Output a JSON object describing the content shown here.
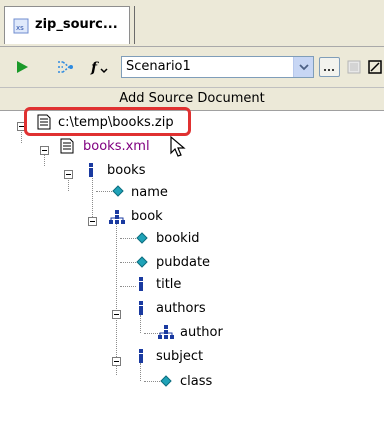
{
  "tab": {
    "title": "zip_sourc...",
    "icon": "xsd-file-icon"
  },
  "toolbar": {
    "run_icon": "play-icon",
    "mapping_icon": "mapping-icon",
    "function_icon": "function-icon",
    "scenario_value": "Scenario1",
    "dropdown_icon": "chevron-down-icon",
    "ellipsis_icon": "ellipsis-icon"
  },
  "source_header": "Add Source Document",
  "tree": {
    "root": {
      "label": "c:\\temp\\books.zip",
      "icon": "document-icon"
    },
    "file": {
      "label": "books.xml",
      "icon": "document-icon",
      "color": "#800080"
    },
    "nodes": [
      {
        "label": "books",
        "icon": "element-icon"
      },
      {
        "label": "name",
        "icon": "attribute-icon"
      },
      {
        "label": "book",
        "icon": "complex-element-icon"
      },
      {
        "label": "bookid",
        "icon": "attribute-icon"
      },
      {
        "label": "pubdate",
        "icon": "attribute-icon"
      },
      {
        "label": "title",
        "icon": "element-icon"
      },
      {
        "label": "authors",
        "icon": "element-icon"
      },
      {
        "label": "author",
        "icon": "complex-element-icon"
      },
      {
        "label": "subject",
        "icon": "element-icon"
      },
      {
        "label": "class",
        "icon": "attribute-icon"
      }
    ]
  },
  "colors": {
    "highlight": "#e03131",
    "attribute": "#1fa3b8",
    "element": "#1a3aa0"
  }
}
